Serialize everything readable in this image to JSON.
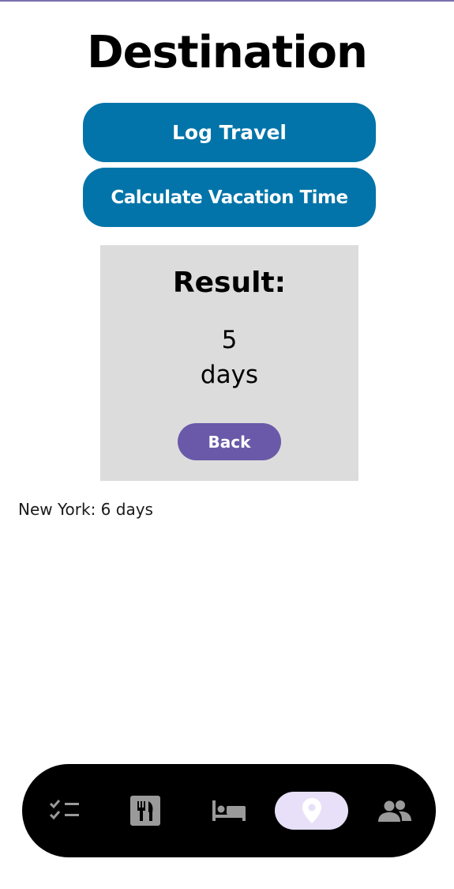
{
  "header": {
    "title": "Destination"
  },
  "actions": {
    "log_travel_label": "Log Travel",
    "calculate_label": "Calculate Vacation Time"
  },
  "result": {
    "heading": "Result:",
    "value": "5",
    "unit": "days",
    "back_label": "Back"
  },
  "log": {
    "entries": [
      "New York: 6 days"
    ]
  },
  "bottom_nav": {
    "items": [
      {
        "icon": "checklist-icon",
        "selected": false
      },
      {
        "icon": "restaurant-icon",
        "selected": false
      },
      {
        "icon": "bed-icon",
        "selected": false
      },
      {
        "icon": "location-pin-icon",
        "selected": true
      },
      {
        "icon": "people-icon",
        "selected": false
      }
    ]
  },
  "colors": {
    "primary_button": "#0274a9",
    "back_button": "#6a59a8",
    "result_panel": "#dcdcdc",
    "nav_background": "#000000",
    "nav_selected_pill": "#e7e0f8",
    "nav_icon": "#9a9a9a"
  }
}
